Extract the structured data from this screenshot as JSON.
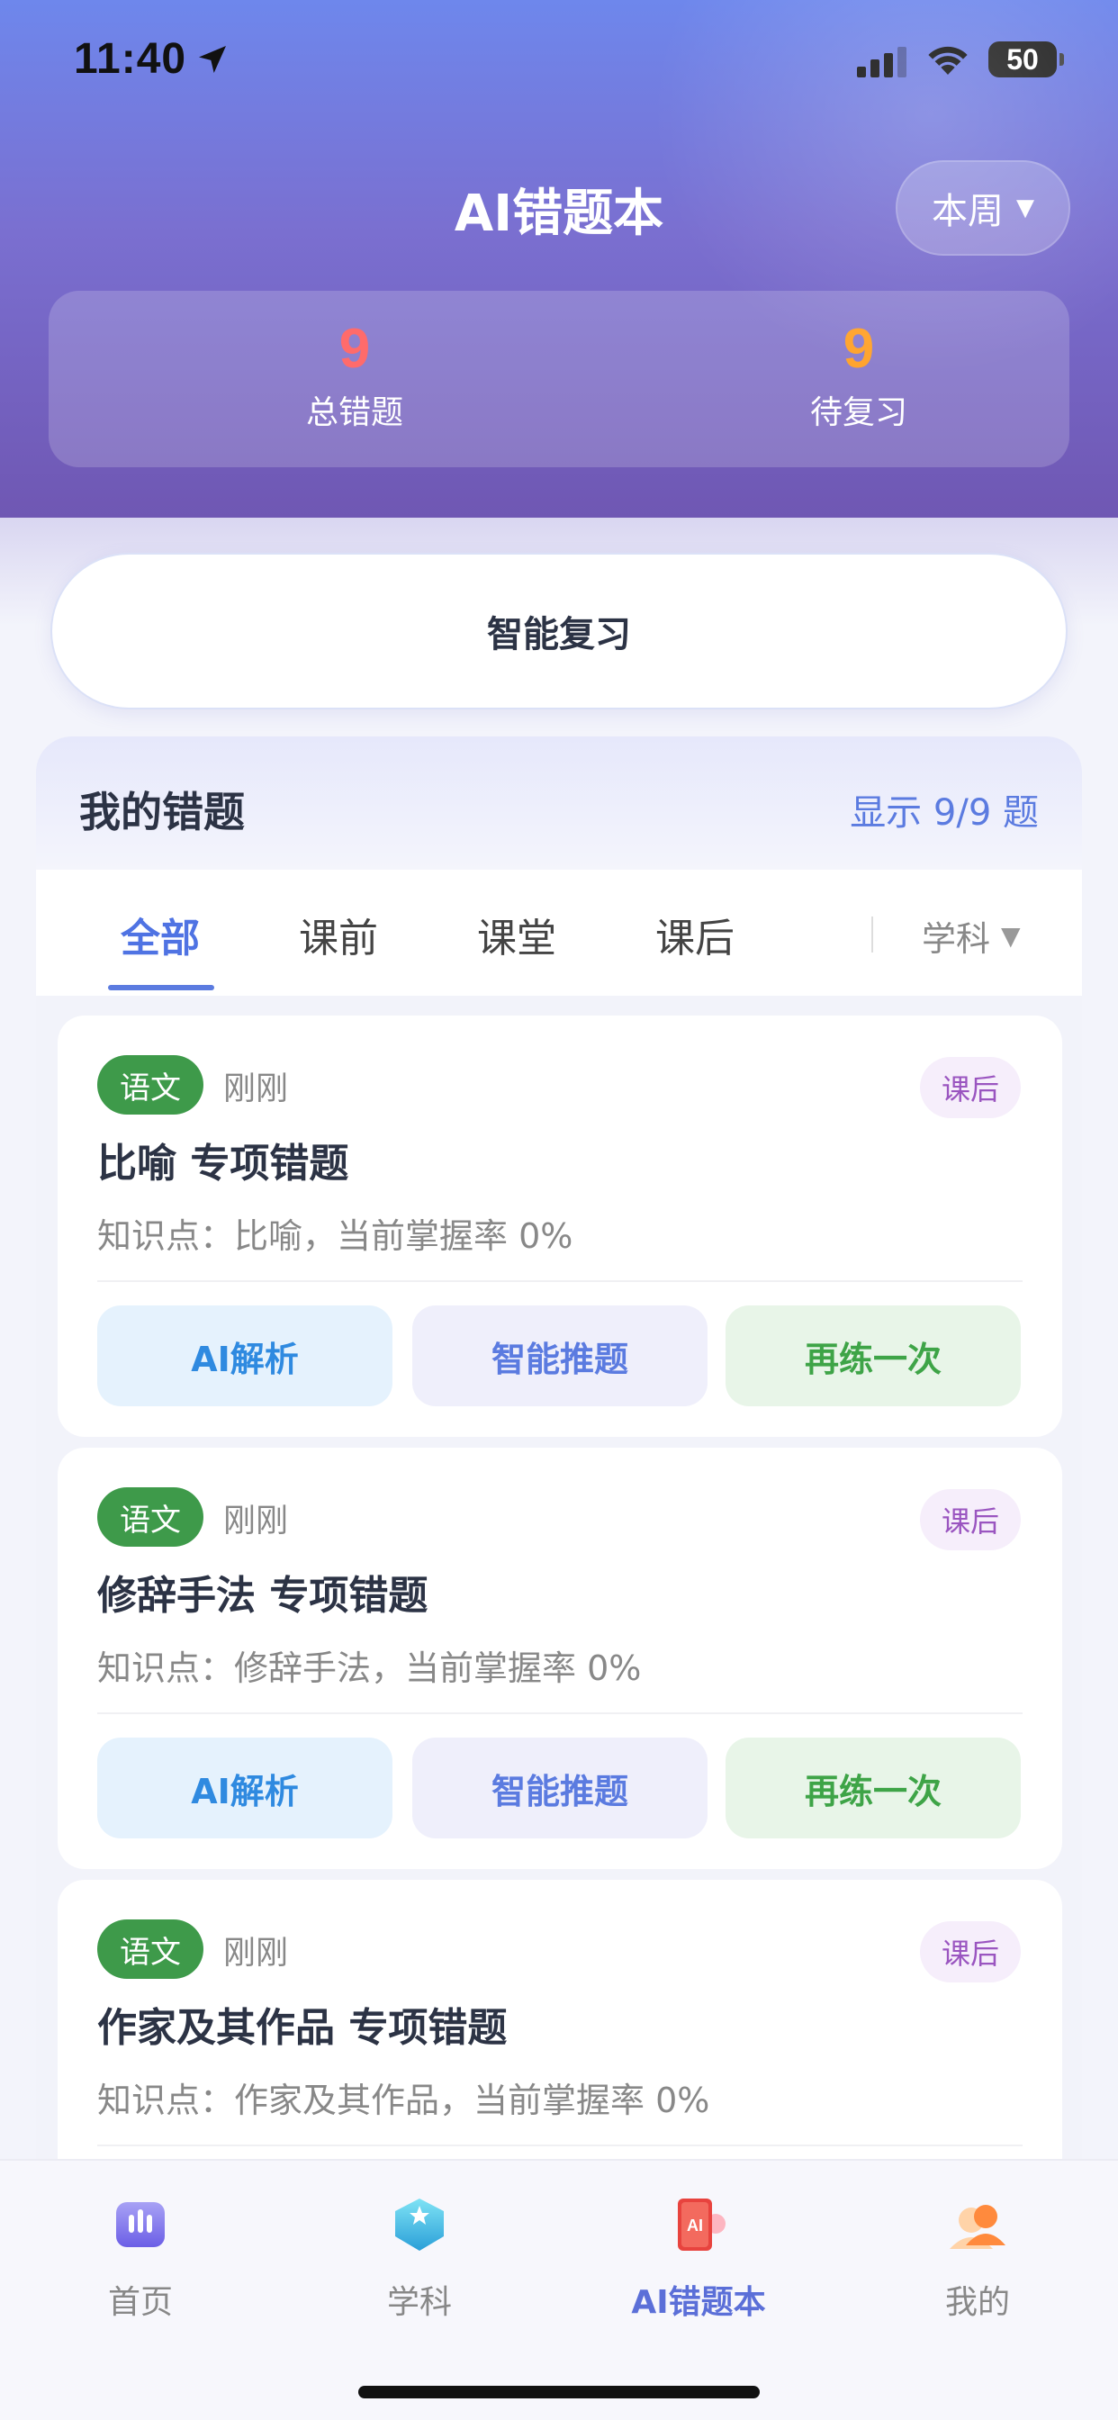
{
  "status_bar": {
    "time": "11:40",
    "battery": "50"
  },
  "header": {
    "title": "AI错题本",
    "period_label": "本周",
    "period_arrow": "▼"
  },
  "stats": [
    {
      "value": "9",
      "label": "总错题"
    },
    {
      "value": "9",
      "label": "待复习"
    }
  ],
  "review_button": "智能复习",
  "panel": {
    "title": "我的错题",
    "count_text": "显示 9/9 题"
  },
  "tabs": [
    "全部",
    "课前",
    "课堂",
    "课后"
  ],
  "subject_filter": {
    "label": "学科",
    "arrow": "▼"
  },
  "cards": [
    {
      "subject": "语文",
      "time": "刚刚",
      "phase": "课后",
      "title": "比喻 专项错题",
      "knowledge": "知识点：比喻，当前掌握率 0%",
      "actions": [
        "AI解析",
        "智能推题",
        "再练一次"
      ]
    },
    {
      "subject": "语文",
      "time": "刚刚",
      "phase": "课后",
      "title": "修辞手法 专项错题",
      "knowledge": "知识点：修辞手法，当前掌握率 0%",
      "actions": [
        "AI解析",
        "智能推题",
        "再练一次"
      ]
    },
    {
      "subject": "语文",
      "time": "刚刚",
      "phase": "课后",
      "title": "作家及其作品 专项错题",
      "knowledge": "知识点：作家及其作品，当前掌握率 0%"
    }
  ],
  "tabbar": [
    {
      "label": "首页",
      "icon": "home-icon"
    },
    {
      "label": "学科",
      "icon": "subject-icon"
    },
    {
      "label": "AI错题本",
      "icon": "ai-notebook-icon"
    },
    {
      "label": "我的",
      "icon": "profile-icon"
    }
  ],
  "colors": {
    "accent": "#5b7be0",
    "total_errors": "#ff6b6b",
    "pending_review": "#ffa42e",
    "subject_tag": "#3e9a4a"
  }
}
